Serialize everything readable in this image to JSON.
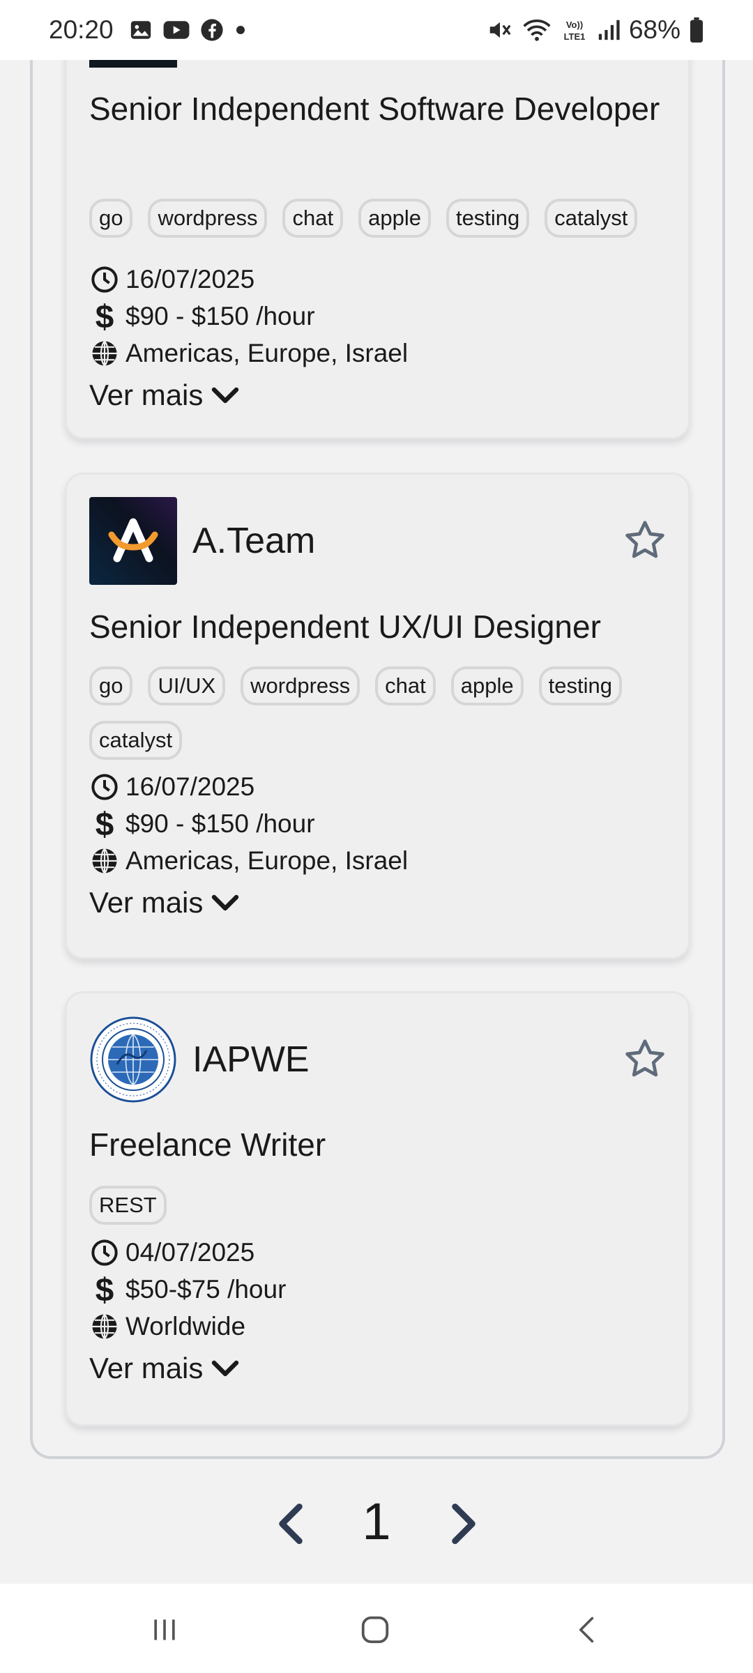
{
  "status_bar": {
    "time": "20:20",
    "battery": "68%",
    "network_label": "VoLTE1",
    "icons": [
      "gallery-icon",
      "youtube-icon",
      "facebook-icon",
      "dot-icon",
      "mute-icon",
      "wifi-icon",
      "volte-icon",
      "signal-icon",
      "battery-icon"
    ]
  },
  "cards": [
    {
      "company": "",
      "title": "Senior Independent Software Developer",
      "tags": [
        "go",
        "wordpress",
        "chat",
        "apple",
        "testing",
        "catalyst"
      ],
      "date": "16/07/2025",
      "salary": "$90 - $150 /hour",
      "location": "Americas, Europe, Israel",
      "more_label": "Ver mais"
    },
    {
      "company": "A.Team",
      "title": "Senior Independent UX/UI Designer",
      "tags": [
        "go",
        "UI/UX",
        "wordpress",
        "chat",
        "apple",
        "testing",
        "catalyst"
      ],
      "date": "16/07/2025",
      "salary": "$90 - $150 /hour",
      "location": "Americas, Europe, Israel",
      "more_label": "Ver mais"
    },
    {
      "company": "IAPWE",
      "title": "Freelance Writer",
      "tags": [
        "REST"
      ],
      "date": "04/07/2025",
      "salary": "$50-$75 /hour",
      "location": "Worldwide",
      "more_label": "Ver mais"
    }
  ],
  "pagination": {
    "current_page": "1"
  },
  "colors": {
    "background": "#f2f2f3",
    "card": "#efefef",
    "star": "#6b7280",
    "pager_arrow": "#2f3b52"
  }
}
